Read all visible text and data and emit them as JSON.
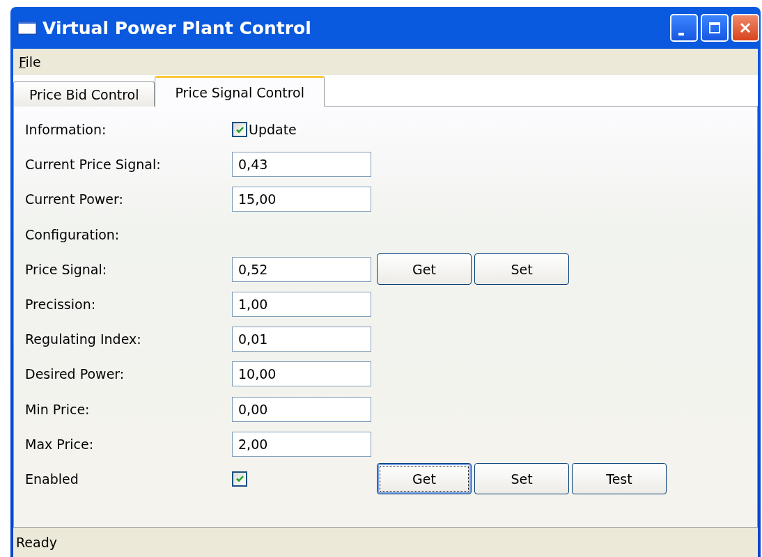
{
  "window": {
    "title": "Virtual Power Plant Control"
  },
  "menu": [
    {
      "label": "File"
    }
  ],
  "tabs": [
    {
      "label": "Price Bid Control",
      "selected": false
    },
    {
      "label": "Price Signal Control",
      "selected": true
    }
  ],
  "rows": [
    {
      "kind": "check",
      "label": "Information:",
      "checked": true,
      "text": "Update"
    },
    {
      "kind": "field",
      "label": "Current Price Signal:",
      "value": "0,43"
    },
    {
      "kind": "field",
      "label": "Current Power:",
      "value": "15,00"
    },
    {
      "kind": "heading",
      "label": "Configuration:"
    },
    {
      "kind": "field",
      "label": "Price Signal:",
      "value": "0,52",
      "buttons": [
        {
          "label": "Get",
          "focused": false
        },
        {
          "label": "Set",
          "focused": false
        }
      ]
    },
    {
      "kind": "field",
      "label": "Precission:",
      "value": "1,00"
    },
    {
      "kind": "field",
      "label": "Regulating Index:",
      "value": "0,01"
    },
    {
      "kind": "field",
      "label": "Desired Power:",
      "value": "10,00"
    },
    {
      "kind": "field",
      "label": "Min Price:",
      "value": "0,00"
    },
    {
      "kind": "field",
      "label": "Max Price:",
      "value": "2,00"
    },
    {
      "kind": "check",
      "label": "Enabled",
      "checked": true,
      "buttons": [
        {
          "label": "Get",
          "focused": true
        },
        {
          "label": "Set",
          "focused": false
        },
        {
          "label": "Test",
          "focused": false
        }
      ]
    }
  ],
  "status_bar": {
    "text": "Ready"
  }
}
